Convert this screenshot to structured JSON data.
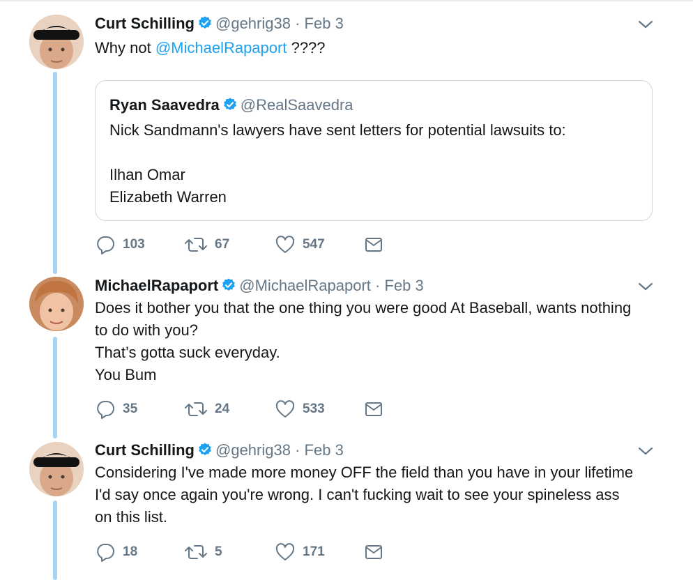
{
  "tweets": [
    {
      "name": "Curt Schilling",
      "handle": "@gehrig38",
      "separator": "·",
      "date": "Feb 3",
      "text_prefix": "Why not ",
      "mention": "@MichaelRapaport",
      "text_suffix": " ????",
      "replies": "103",
      "retweets": "67",
      "likes": "547",
      "quote": {
        "name": "Ryan Saavedra",
        "handle": "@RealSaavedra",
        "lines": [
          "Nick Sandmann's lawyers have sent letters for potential lawsuits to:",
          "",
          "Ilhan Omar",
          "Elizabeth Warren"
        ]
      }
    },
    {
      "name": "MichaelRapaport",
      "handle": "@MichaelRapaport",
      "separator": "·",
      "date": "Feb 3",
      "lines": [
        "Does it bother you that the one thing you were good At Baseball, wants nothing",
        "to do with you?",
        "That’s gotta suck everyday.",
        "You Bum"
      ],
      "replies": "35",
      "retweets": "24",
      "likes": "533"
    },
    {
      "name": "Curt Schilling",
      "handle": "@gehrig38",
      "separator": "·",
      "date": "Feb 3",
      "lines": [
        "Considering I've made more money OFF the field than you have in your lifetime",
        "I'd say once again you're wrong. I can't fucking wait to see your spineless ass",
        "on this list."
      ],
      "replies": "18",
      "retweets": "5",
      "likes": "171"
    }
  ],
  "icons": {
    "reply": "reply-icon",
    "retweet": "retweet-icon",
    "like": "heart-icon",
    "dm": "envelope-icon",
    "verified": "verified-badge-icon",
    "more": "chevron-down-icon"
  },
  "colors": {
    "link": "#1da1f2",
    "secondary_text": "#657786",
    "thread_line": "#a6d4f2",
    "border": "#ccd6dd"
  }
}
